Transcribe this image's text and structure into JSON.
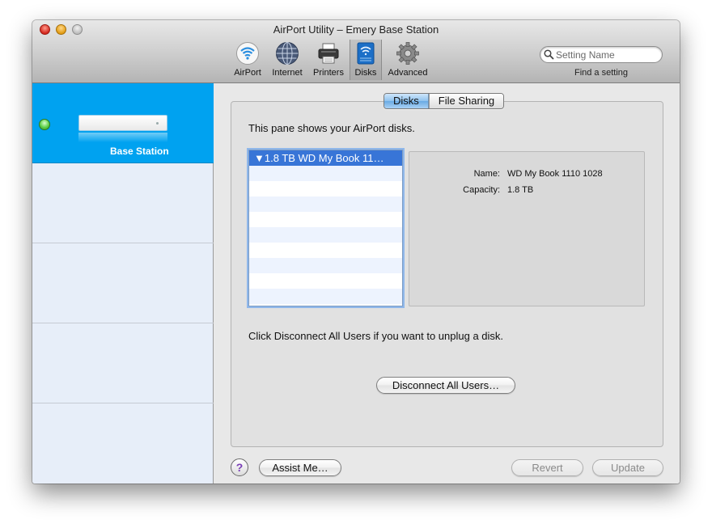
{
  "window": {
    "title": "AirPort Utility – Emery Base Station"
  },
  "toolbar": {
    "items": [
      {
        "label": "AirPort",
        "icon": "airport-wifi-icon"
      },
      {
        "label": "Internet",
        "icon": "globe-icon"
      },
      {
        "label": "Printers",
        "icon": "printer-icon"
      },
      {
        "label": "Disks",
        "icon": "disk-icon",
        "selected": true
      },
      {
        "label": "Advanced",
        "icon": "gear-icon"
      }
    ],
    "search_placeholder": "Setting Name",
    "search_caption": "Find a setting"
  },
  "sidebar": {
    "items": [
      {
        "name": "Base Station",
        "status": "online"
      }
    ]
  },
  "main": {
    "tabs": [
      {
        "label": "Disks",
        "selected": true
      },
      {
        "label": "File Sharing",
        "selected": false
      }
    ],
    "intro": "This pane shows your AirPort disks.",
    "disk_list": {
      "items": [
        "▼1.8 TB WD My Book 11…"
      ]
    },
    "details": {
      "name_label": "Name:",
      "name_value": "WD My Book 1110 1028",
      "capacity_label": "Capacity:",
      "capacity_value": "1.8 TB"
    },
    "hint": "Click Disconnect All Users if you want to unplug a disk.",
    "disconnect_button": "Disconnect All Users…"
  },
  "footer": {
    "help_label": "?",
    "assist_button": "Assist Me…",
    "revert_button": "Revert",
    "update_button": "Update"
  },
  "colors": {
    "sidebar_selected": "#00a2f0",
    "list_selection": "#3875d7",
    "status_online": "#5fd04a"
  }
}
